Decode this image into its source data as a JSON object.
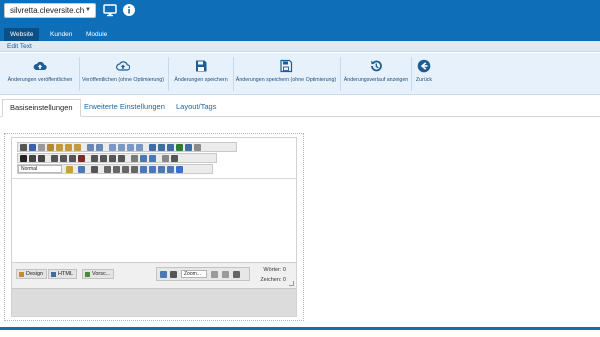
{
  "header": {
    "site_select": "silvretta.cleversite.ch",
    "icons": [
      "monitor-icon",
      "info-icon"
    ],
    "brand_color": "#0e6eb8"
  },
  "nav": {
    "tabs": [
      {
        "label": "Website",
        "active": true
      },
      {
        "label": "Kunden",
        "active": false
      },
      {
        "label": "Module",
        "active": false
      }
    ]
  },
  "editbar": {
    "label": "Edit Text"
  },
  "actions": [
    {
      "label": "Änderungen veröffentlichen",
      "icon": "cloud-upload-icon"
    },
    {
      "label": "Veröffentlichen (ohne Optimierung)",
      "icon": "cloud-upload-outline-icon"
    },
    {
      "label": "Änderungen speichern",
      "icon": "save-icon"
    },
    {
      "label": "Änderungen speichern (ohne Optimierung)",
      "icon": "save-outline-icon"
    },
    {
      "label": "Änderungsverlauf anzeigen",
      "icon": "history-icon"
    },
    {
      "label": "Zurück",
      "icon": "back-arrow-icon"
    }
  ],
  "tabs": [
    {
      "label": "Basiseinstellungen",
      "active": true
    },
    {
      "label": "Erweiterte Einstellungen",
      "active": false
    },
    {
      "label": "Layout/Tags",
      "active": false
    }
  ],
  "editor": {
    "style_select": "Normal",
    "modes": [
      {
        "label": "Design",
        "icon": "design-icon"
      },
      {
        "label": "HTML",
        "icon": "html-icon"
      },
      {
        "label": "Vorsc...",
        "icon": "preview-icon"
      }
    ],
    "zoom_select": "Zoom...",
    "words_label": "Wörter: 0",
    "chars_label": "Zeichen: 0"
  }
}
